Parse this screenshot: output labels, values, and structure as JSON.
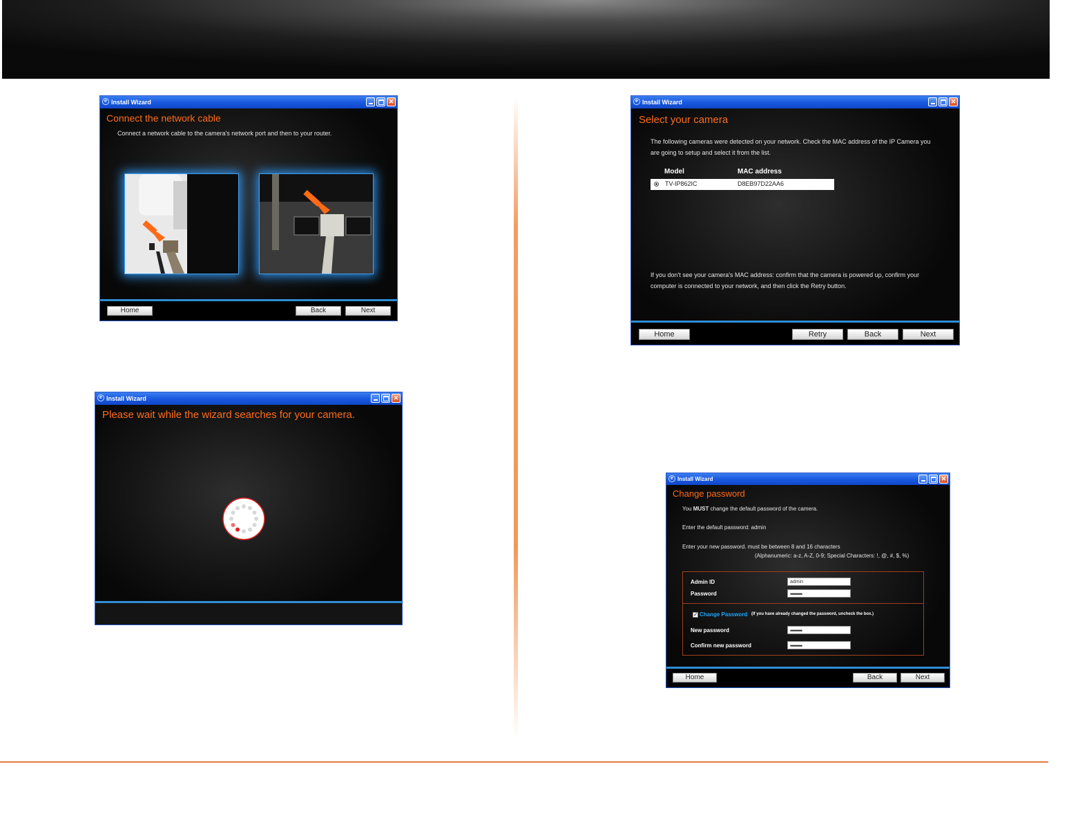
{
  "window_title": "Install Wizard",
  "win1": {
    "title": "Connect the network cable",
    "instruction": "Connect a network cable to the camera's network port and then to your router.",
    "buttons": {
      "home": "Home",
      "back": "Back",
      "next": "Next"
    }
  },
  "win2": {
    "title": "Please wait while the wizard searches for your camera."
  },
  "win3": {
    "title": "Select your camera",
    "intro": "The following cameras were detected on your network. Check the MAC address of the IP Camera you are going to setup and select it from the list.",
    "table": {
      "headers": [
        "Model",
        "MAC address"
      ],
      "rows": [
        {
          "model": "TV-IP862IC",
          "mac": "D8EB97D22AA6"
        }
      ]
    },
    "help": "If you don't see your camera's MAC address: confirm that the camera is powered up, confirm your computer is connected to your network, and then click the Retry button.",
    "buttons": {
      "home": "Home",
      "retry": "Retry",
      "back": "Back",
      "next": "Next"
    }
  },
  "win4": {
    "title": "Change password",
    "must_prefix": "You ",
    "must_bold": "MUST",
    "must_suffix": " change the default password of the camera.",
    "default_pw_line": "Enter the default password: admin",
    "new_pw_line": "Enter your new password. must be between 8 and 16 characters",
    "charset_line": "(Alphanumeric: a-z, A-Z, 0-9; Special Characters: !, @, #, $, %)",
    "admin_id_label": "Admin ID",
    "admin_id_value": "admin",
    "password_label": "Password",
    "password_value": "••••••••",
    "change_password_label": "Change Password",
    "change_password_note": "(If you have already changed the password, uncheck the box.)",
    "new_password_label": "New password",
    "new_password_value": "••••••••",
    "confirm_password_label": "Confirm new password",
    "confirm_password_value": "••••••••",
    "buttons": {
      "home": "Home",
      "back": "Back",
      "next": "Next"
    }
  },
  "colors": {
    "accent_orange": "#ff6c1a",
    "title_blue": "#1a5ae0",
    "link_blue": "#1ea7ff"
  }
}
